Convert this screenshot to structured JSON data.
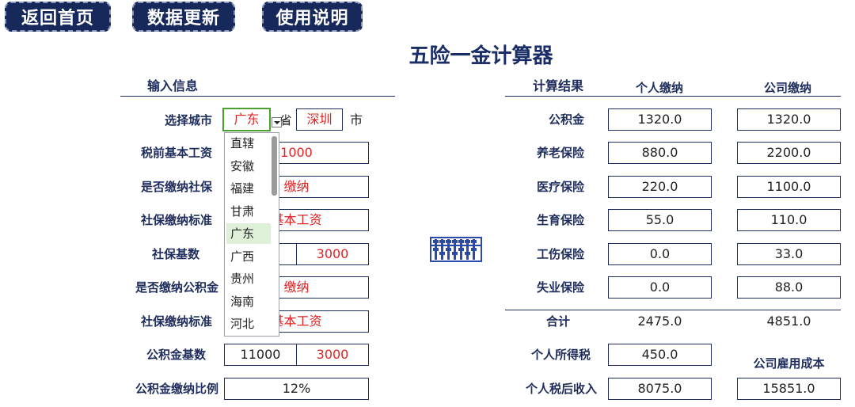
{
  "toolbar": {
    "home": "返回首页",
    "update": "数据更新",
    "help": "使用说明"
  },
  "title": "五险一金计算器",
  "input": {
    "section_title": "输入信息",
    "city_label": "选择城市",
    "province_value": "广东",
    "province_suffix": "省",
    "city_value": "深圳",
    "city_suffix": "市",
    "salary_label": "税前基本工资",
    "salary_value": "1000",
    "social_label": "是否缴纳社保",
    "social_value": "缴纳",
    "social_std_label": "社保缴纳标准",
    "social_std_value": "基本工资",
    "social_base_label": "社保基数",
    "social_base_right": "3000",
    "fund_label": "是否缴纳公积金",
    "fund_value": "缴纳",
    "fund_std_label": "社保缴纳标准",
    "fund_std_value": "基本工资",
    "fund_base_label": "公积金基数",
    "fund_base_left": "11000",
    "fund_base_right": "3000",
    "fund_ratio_label": "公积金缴纳比例",
    "fund_ratio_value": "12%"
  },
  "dropdown": {
    "options": [
      "直辖",
      "安徽",
      "福建",
      "甘肃",
      "广东",
      "广西",
      "贵州",
      "海南",
      "河北"
    ],
    "selected": "广东"
  },
  "result": {
    "section_title": "计算结果",
    "col_personal": "个人缴纳",
    "col_company": "公司缴纳",
    "rows": [
      {
        "label": "公积金",
        "personal": "1320.0",
        "company": "1320.0"
      },
      {
        "label": "养老保险",
        "personal": "880.0",
        "company": "2200.0"
      },
      {
        "label": "医疗保险",
        "personal": "220.0",
        "company": "1100.0"
      },
      {
        "label": "生育保险",
        "personal": "55.0",
        "company": "110.0"
      },
      {
        "label": "工伤保险",
        "personal": "0.0",
        "company": "33.0"
      },
      {
        "label": "失业保险",
        "personal": "0.0",
        "company": "88.0"
      }
    ],
    "total_label": "合计",
    "total_personal": "2475.0",
    "total_company": "4851.0",
    "tax_label": "个人所得税",
    "tax_value": "450.0",
    "cost_label": "公司雇用成本",
    "net_label": "个人税后收入",
    "net_value": "8075.0",
    "cost_value": "15851.0"
  }
}
